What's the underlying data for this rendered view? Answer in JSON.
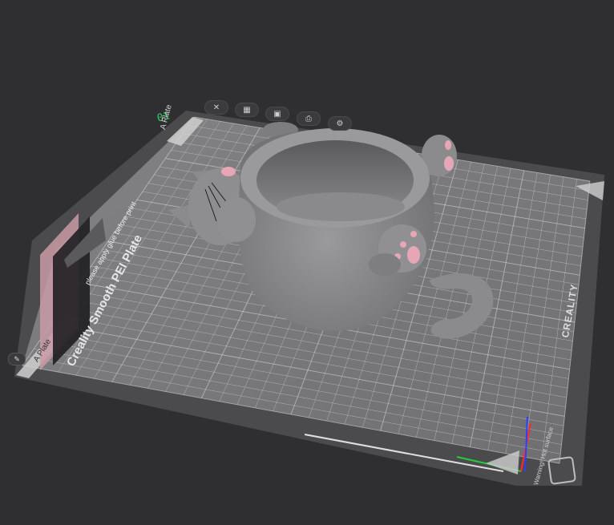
{
  "plate": {
    "number": "01",
    "name": "A Plate",
    "name_bottom": "A Plate",
    "tip_text": "please apply glue before print",
    "surface_text": "Creality Smooth PEI Plate",
    "brand_text": "CREALITY",
    "warning_text": "Warning! Hot surface"
  },
  "toolbar": {
    "buttons": [
      {
        "name": "close",
        "icon": "close-icon",
        "glyph": "✕"
      },
      {
        "name": "arrange",
        "icon": "arrange-icon",
        "glyph": "▦"
      },
      {
        "name": "lock",
        "icon": "lock-icon",
        "glyph": "▣"
      },
      {
        "name": "print",
        "icon": "print-icon",
        "glyph": "⎙"
      },
      {
        "name": "settings",
        "icon": "gear-icon",
        "glyph": "⚙"
      }
    ]
  },
  "colors": {
    "background": "#2f2f31",
    "bed": "#7b7b7d",
    "grid_line": "#d9d9d9",
    "frame": "#4b4b4d",
    "model": "#8a8a8c",
    "paw_pad": "#e6a6b6",
    "axis_x": "#1fcf3a",
    "axis_y": "#ff2a2a",
    "axis_z": "#2741ff",
    "plate_number": "#32d06a"
  },
  "model": {
    "name": "Cat planter"
  }
}
